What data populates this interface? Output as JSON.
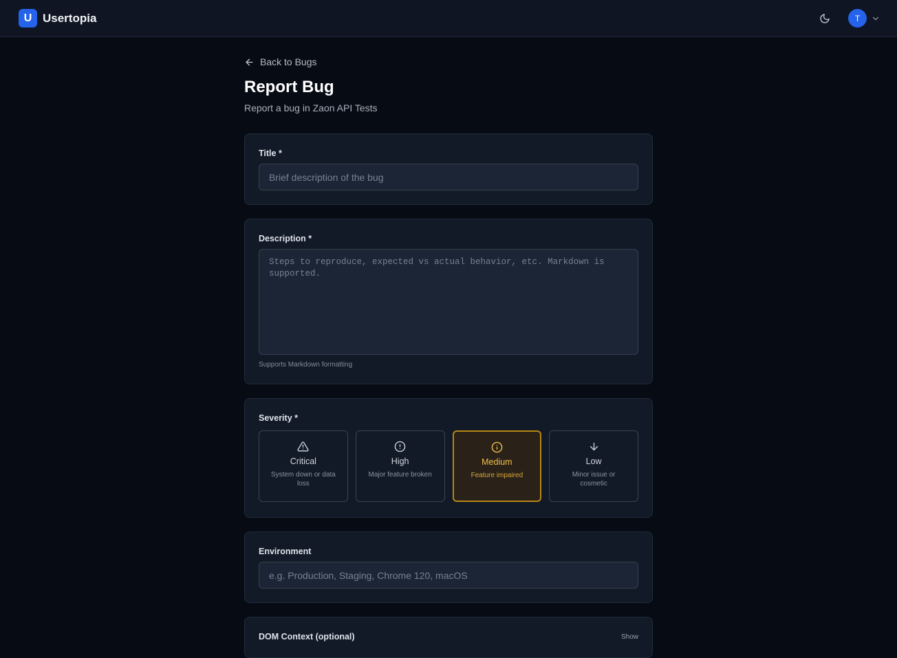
{
  "app": {
    "logo_letter": "U",
    "name": "Usertopia"
  },
  "user": {
    "avatar_initial": "T"
  },
  "back_link": "Back to Bugs",
  "page": {
    "title": "Report Bug",
    "subtitle": "Report a bug in Zaon API Tests"
  },
  "title_field": {
    "label": "Title *",
    "placeholder": "Brief description of the bug",
    "value": ""
  },
  "description_field": {
    "label": "Description *",
    "placeholder": "Steps to reproduce, expected vs actual behavior, etc. Markdown is supported.",
    "value": "",
    "hint": "Supports Markdown formatting"
  },
  "severity": {
    "label": "Severity *",
    "selected": "Medium",
    "options": [
      {
        "name": "Critical",
        "desc": "System down or data loss",
        "icon": "warning-triangle-icon"
      },
      {
        "name": "High",
        "desc": "Major feature broken",
        "icon": "alert-circle-icon"
      },
      {
        "name": "Medium",
        "desc": "Feature impaired",
        "icon": "info-circle-icon"
      },
      {
        "name": "Low",
        "desc": "Minor issue or cosmetic",
        "icon": "arrow-down-icon"
      }
    ]
  },
  "environment_field": {
    "label": "Environment",
    "placeholder": "e.g. Production, Staging, Chrome 120, macOS",
    "value": ""
  },
  "dom_context": {
    "label": "DOM Context (optional)",
    "toggle_label": "Show"
  },
  "colors": {
    "accent": "#2563eb",
    "selected_severity": "#b98714",
    "background": "#070b14",
    "card": "#121a27"
  }
}
